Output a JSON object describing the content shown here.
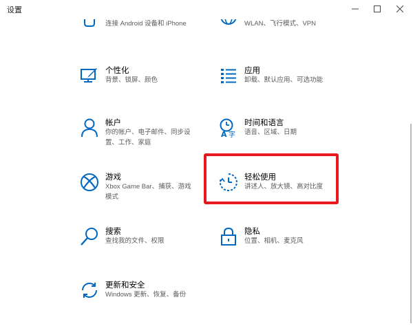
{
  "window": {
    "title": "设置",
    "minimize_icon": "minimize-icon",
    "maximize_icon": "maximize-icon",
    "close_icon": "close-icon"
  },
  "accent_color": "#0067c0",
  "highlight_color": "#e8191c",
  "tiles": [
    {
      "id": "phone",
      "name": "",
      "desc": "连接 Android 设备和 iPhone",
      "icon": "phone-icon"
    },
    {
      "id": "network",
      "name": "",
      "desc": "WLAN、飞行模式、VPN",
      "icon": "globe-icon"
    },
    {
      "id": "personalization",
      "name": "个性化",
      "desc": "背景、锁屏、颜色",
      "icon": "paint-monitor-icon"
    },
    {
      "id": "apps",
      "name": "应用",
      "desc": "卸载、默认应用、可选功能",
      "icon": "app-list-icon"
    },
    {
      "id": "accounts",
      "name": "帐户",
      "desc": "你的帐户、电子邮件、同步设置、工作、家庭",
      "icon": "person-icon"
    },
    {
      "id": "time-language",
      "name": "时间和语言",
      "desc": "语音、区域、日期",
      "icon": "time-language-icon"
    },
    {
      "id": "gaming",
      "name": "游戏",
      "desc": "Xbox Game Bar、捕获、游戏模式",
      "icon": "xbox-icon"
    },
    {
      "id": "ease-of-access",
      "name": "轻松使用",
      "desc": "讲述人、放大镜、高对比度",
      "icon": "ease-of-access-icon"
    },
    {
      "id": "search",
      "name": "搜索",
      "desc": "查找我的文件、权限",
      "icon": "search-icon"
    },
    {
      "id": "privacy",
      "name": "隐私",
      "desc": "位置、相机、麦克风",
      "icon": "lock-icon"
    },
    {
      "id": "update-security",
      "name": "更新和安全",
      "desc": "Windows 更新、恢复、备份",
      "icon": "sync-icon"
    }
  ]
}
